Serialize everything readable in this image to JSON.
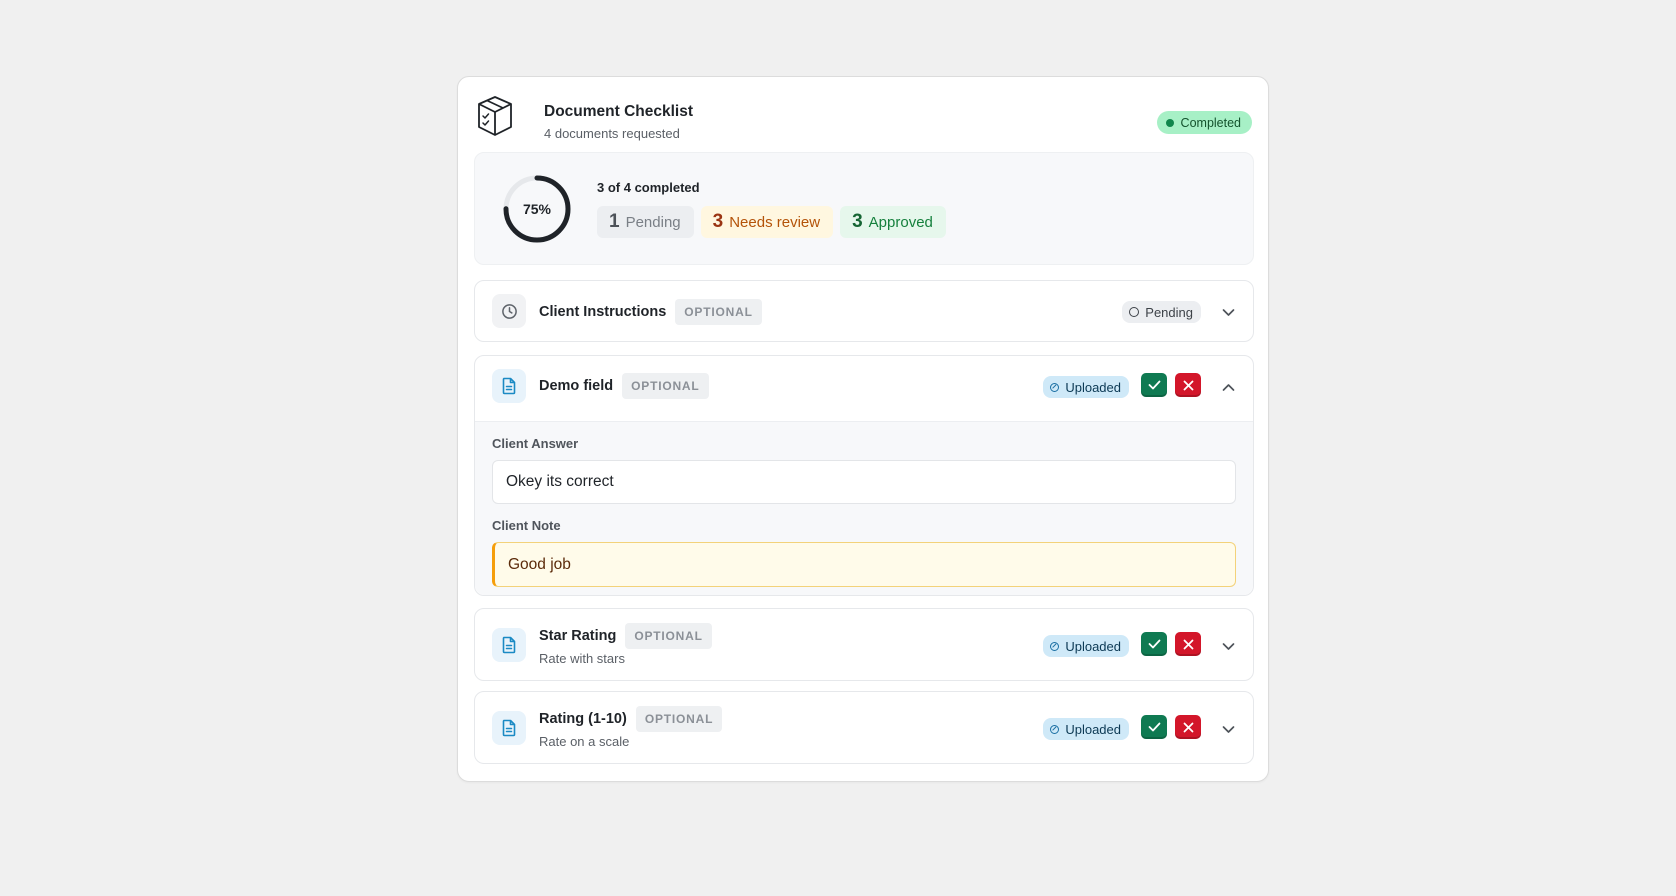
{
  "header": {
    "title": "Document Checklist",
    "subtitle": "4 documents requested",
    "status": "Completed",
    "logo_icon": "package-checklist-icon"
  },
  "summary": {
    "progress_percent": 75,
    "progress_label": "75%",
    "completed_text": "3 of 4 completed",
    "chips": {
      "pending_count": "1",
      "pending_label": "Pending",
      "review_count": "3",
      "review_label": "Needs review",
      "approved_count": "3",
      "approved_label": "Approved"
    }
  },
  "items": [
    {
      "name": "Client Instructions",
      "tag": "OPTIONAL",
      "status": "Pending",
      "icon": "clock-icon",
      "expanded": false
    },
    {
      "name": "Demo field",
      "tag": "OPTIONAL",
      "status": "Uploaded",
      "icon": "document-icon",
      "expanded": true,
      "answer_label": "Client Answer",
      "answer": "Okey its correct",
      "note_label": "Client Note",
      "note": "Good job"
    },
    {
      "name": "Star Rating",
      "tag": "OPTIONAL",
      "desc": "Rate with stars",
      "status": "Uploaded",
      "icon": "document-icon",
      "expanded": false
    },
    {
      "name": "Rating (1-10)",
      "tag": "OPTIONAL",
      "desc": "Rate on a scale",
      "status": "Uploaded",
      "icon": "document-icon",
      "expanded": false
    }
  ],
  "colors": {
    "completed_bg": "#a7f0c6",
    "approve": "#0f7a52",
    "reject": "#d3162a",
    "uploaded_bg": "#cfe9f8",
    "note_accent": "#f59e0b"
  }
}
